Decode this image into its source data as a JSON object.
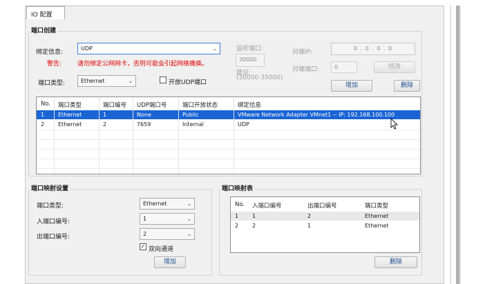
{
  "tab": {
    "label": "IO 配置"
  },
  "port_create": {
    "title": "端口创建",
    "bind_info_label": "绑定信息:",
    "bind_info_value": "UDP",
    "warning_label": "警告:",
    "warning_text": "请勿绑定公网网卡，否则可能会引起网络瘫痪。",
    "port_type_label": "端口类型:",
    "port_type_value": "Ethernet",
    "open_udp_label": "开放UDP端口",
    "listen_port_label": "监听端口:",
    "listen_port_value": "30000",
    "suggest_label": "建议:",
    "suggest_range": "(30000-35000)",
    "peer_ip_label": "对端IP:",
    "peer_ip_value": "0 . 0 . 0 . 0",
    "peer_port_label": "对端端口:",
    "peer_port_value": "0",
    "modify_button": "修改",
    "add_button": "增加",
    "delete_button": "删除"
  },
  "port_table": {
    "columns": [
      "No.",
      "端口类型",
      "端口编号",
      "UDP端口号",
      "端口开放状态",
      "绑定信息"
    ],
    "rows": [
      [
        "1",
        "Ethernet",
        "1",
        "None",
        "Public",
        "VMware Network Adapter VMnet1 -- IP: 192.168.100.100"
      ],
      [
        "2",
        "Ethernet",
        "2",
        "7659",
        "Internal",
        "UDP"
      ]
    ]
  },
  "mapping_settings": {
    "title": "端口映射设置",
    "port_type_label": "端口类型:",
    "port_type_value": "Ethernet",
    "in_port_label": "入端口编号:",
    "in_port_value": "1",
    "out_port_label": "出端口编号:",
    "out_port_value": "2",
    "bidirectional_label": "双向通道",
    "add_button": "增加"
  },
  "mapping_table": {
    "title": "端口映射表",
    "columns": [
      "No.",
      "入端口编号",
      "出端口编号",
      "端口类型"
    ],
    "rows": [
      [
        "1",
        "1",
        "2",
        "Ethernet"
      ],
      [
        "2",
        "2",
        "1",
        "Ethernet"
      ]
    ],
    "delete_button": "删除"
  },
  "colors": {
    "accent": "#1a64d4",
    "warning": "#e00000",
    "link": "#1b4d8f"
  },
  "icons": {
    "dropdown": "chevron-down-icon",
    "checkbox": "checkmark-icon",
    "cursor": "mouse-pointer-icon"
  }
}
